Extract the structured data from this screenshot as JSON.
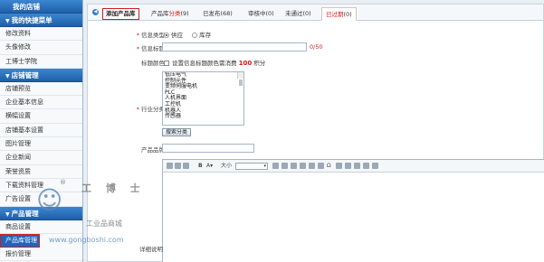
{
  "sidebar": {
    "header": "我的店铺",
    "groups": [
      {
        "title": "我的快捷菜单",
        "items": [
          "修改资料",
          "头像修改",
          "工博士学院"
        ]
      },
      {
        "title": "店铺管理",
        "items": [
          "店铺预览",
          "企业基本信息",
          "横幅设置",
          "店铺基本设置",
          "图片管理",
          "企业新闻",
          "荣誉资质",
          "下载资料管理",
          "广告设置"
        ]
      },
      {
        "title": "产品管理",
        "items": [
          "商品设置",
          "产品库管理",
          "报价管理"
        ]
      }
    ]
  },
  "tabs": {
    "add": "添加产品库",
    "library": {
      "label": "产品库",
      "suffix": "分类",
      "count": "(9)"
    },
    "published": {
      "label": "已发布",
      "count": "(68)"
    },
    "pending": {
      "label": "审核中",
      "count": "(0)"
    },
    "notpassed": {
      "label": "未通过",
      "count": "(0)"
    },
    "deleted": {
      "label": "已过期",
      "count": "(0)"
    }
  },
  "form": {
    "type_label": "信息类型",
    "type_options": [
      "供应",
      "库存"
    ],
    "title_label": "信息标题",
    "title_counter": "0/50",
    "color_label": "标题颜色",
    "color_text": "设置信息标题颜色需消费",
    "color_points": "100",
    "color_unit": "积分",
    "industry_label": "行业分类",
    "industry_options": [
      "低压电气",
      "控制元件",
      "变频伺服电机",
      "PLC",
      "人机界面",
      "工控机",
      "机器人",
      "传感器"
    ],
    "search_btn": "搜索分类",
    "brand_label": "产品品牌",
    "desc_label": "详细说明",
    "font_size_label": "大小"
  },
  "watermark": {
    "title": "工 博 士",
    "subtitle": "工业品商城",
    "url": "www.gongboshi.com",
    "mark": "®"
  }
}
